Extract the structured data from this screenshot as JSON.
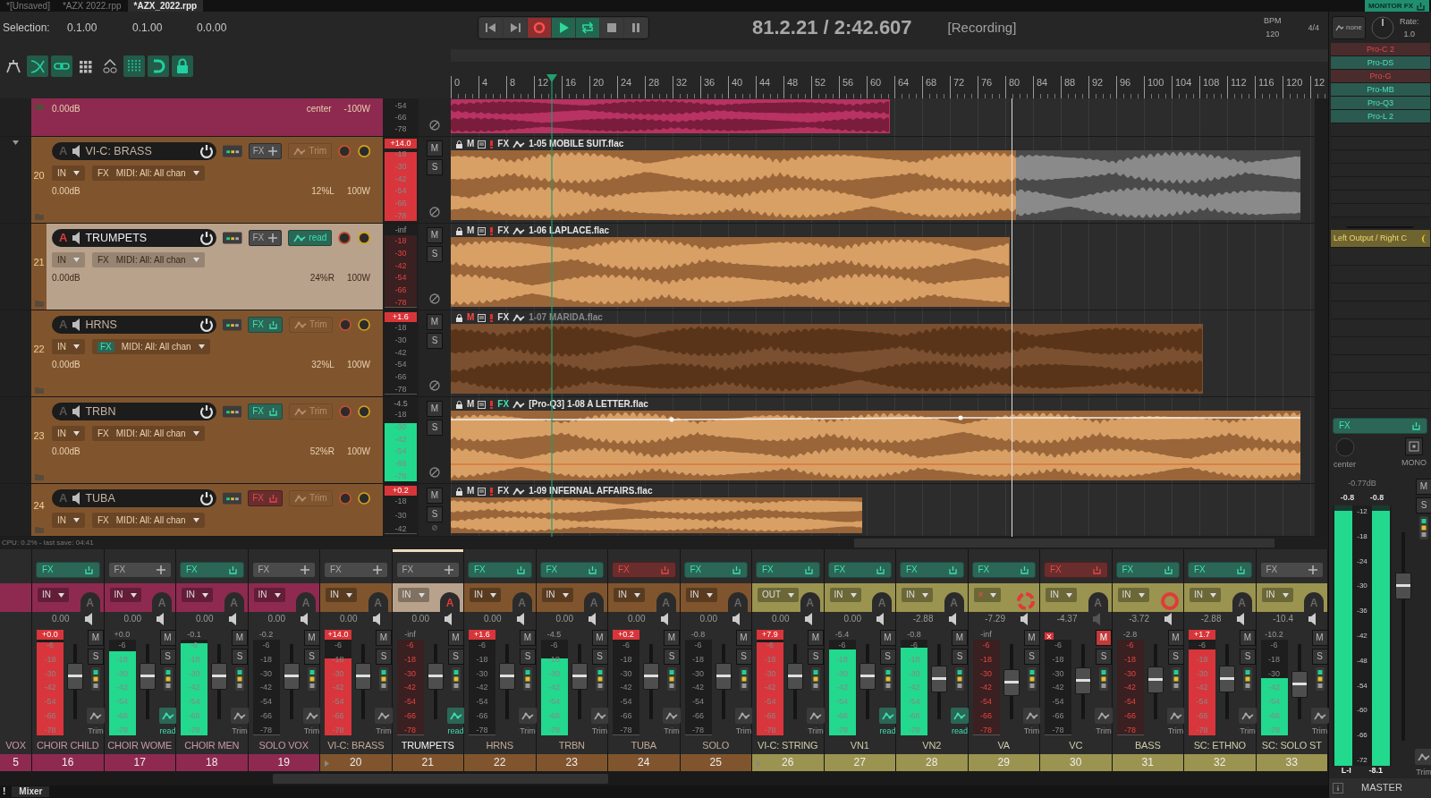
{
  "tabs": [
    {
      "label": "*[Unsaved]",
      "selected": false
    },
    {
      "label": "*AZX 2022.rpp",
      "selected": false
    },
    {
      "label": "*AZX_2022.rpp",
      "selected": true
    }
  ],
  "monitor_fx": {
    "label": "MONITOR FX",
    "on": true
  },
  "selection": {
    "label": "Selection:",
    "start": "0.1.00",
    "end": "0.1.00",
    "length": "0.0.00"
  },
  "transport": {
    "recording": true,
    "playing": true,
    "repeat": true
  },
  "time_display": "81.2.21 / 2:42.607",
  "play_state": "[Recording]",
  "tempo": {
    "label": "BPM",
    "value": "120",
    "signature": "4/4"
  },
  "toolbar": [
    {
      "kind": "ripple",
      "on": false
    },
    {
      "kind": "crossfade",
      "on": true
    },
    {
      "kind": "group",
      "on": true
    },
    {
      "kind": "grid",
      "on": false
    },
    {
      "kind": "envlink",
      "on": false
    },
    {
      "kind": "gridlines",
      "on": true
    },
    {
      "kind": "snap",
      "on": true
    },
    {
      "kind": "lock",
      "on": true
    }
  ],
  "ruler": [
    "0",
    "4",
    "8",
    "12",
    "16",
    "20",
    "24",
    "28",
    "32",
    "36",
    "40",
    "44",
    "48",
    "52",
    "56",
    "60",
    "64",
    "68",
    "72",
    "76",
    "80",
    "84",
    "88",
    "92",
    "96",
    "100",
    "104",
    "108",
    "112",
    "116",
    "120",
    "12"
  ],
  "tracks": [
    {
      "kind": "partial",
      "color": "#8e2a50",
      "selected": false,
      "volume": "0.00dB",
      "pan": "center",
      "width": "-100W",
      "meter": {
        "scale": [
          "-54",
          "-66",
          "-78"
        ]
      }
    },
    {
      "kind": "full",
      "number": "20",
      "folder": true,
      "name": "VI-C: BRASS",
      "color": "#80552e",
      "selected": false,
      "armed": false,
      "a": "A",
      "fx_label": "FX",
      "fx_loaded": false,
      "auto": "Trim",
      "auto_on": false,
      "input": "IN",
      "chain_fx": "FX",
      "chain_fx_on": false,
      "midi": "MIDI: All: All chan",
      "volume": "0.00dB",
      "pan": "12%L",
      "width": "100W",
      "meter": {
        "peak": "+14.0",
        "clip": true,
        "level": 0.95,
        "scale": [
          "-18",
          "-30",
          "-42",
          "-54",
          "-66",
          "-78"
        ]
      },
      "m": "M",
      "s": "S",
      "item": {
        "title": "1-05 MOBILE SUIT.flac",
        "m": "M",
        "fx_label": "FX",
        "muted": false,
        "fx": false,
        "envelope": false
      }
    },
    {
      "kind": "full",
      "number": "21",
      "folder": false,
      "name": "TRUMPETS",
      "color": "#80552e",
      "selected": true,
      "armed": true,
      "a": "A",
      "fx_label": "FX",
      "fx_loaded": false,
      "auto": "read",
      "auto_on": true,
      "input": "IN",
      "chain_fx": "FX",
      "chain_fx_on": false,
      "midi": "MIDI: All: All chan",
      "volume": "0.00dB",
      "pan": "24%R",
      "width": "100W",
      "meter": {
        "peak": "-inf",
        "clip": false,
        "level": 0,
        "scale": [
          "-18",
          "-30",
          "-42",
          "-54",
          "-66",
          "-78"
        ]
      },
      "m": "M",
      "s": "S",
      "item": {
        "title": "1-06 LAPLACE.flac",
        "m": "M",
        "fx_label": "FX",
        "muted": false,
        "fx": false,
        "envelope": false
      }
    },
    {
      "kind": "full",
      "number": "22",
      "folder": false,
      "name": "HRNS",
      "color": "#80552e",
      "selected": false,
      "armed": false,
      "a": "A",
      "fx_label": "FX",
      "fx_loaded": true,
      "fx_bypassed": false,
      "auto": "Trim",
      "auto_on": false,
      "input": "IN",
      "chain_fx": "FX",
      "chain_fx_on": true,
      "midi": "MIDI: All: All chan",
      "volume": "0.00dB",
      "pan": "32%L",
      "width": "100W",
      "meter": {
        "peak": "+1.6",
        "clip": true,
        "level": 0,
        "scale": [
          "-18",
          "-30",
          "-42",
          "-54",
          "-66",
          "-78"
        ]
      },
      "m": "M",
      "s": "S",
      "item": {
        "title": "1-07 MARIDA.flac",
        "m": "M",
        "fx_label": "FX",
        "muted": true,
        "fx": false,
        "envelope": false
      }
    },
    {
      "kind": "full",
      "number": "23",
      "folder": false,
      "name": "TRBN",
      "color": "#80552e",
      "selected": false,
      "armed": false,
      "a": "A",
      "fx_label": "FX",
      "fx_loaded": true,
      "fx_bypassed": false,
      "auto": "Trim",
      "auto_on": false,
      "input": "IN",
      "chain_fx": "FX",
      "chain_fx_on": false,
      "midi": "MIDI: All: All chan",
      "volume": "0.00dB",
      "pan": "52%R",
      "width": "100W",
      "meter": {
        "peak": "-4.5",
        "clip": false,
        "level": 0.8,
        "scale": [
          "-18",
          "-30",
          "-42",
          "-54",
          "-66",
          "-78"
        ]
      },
      "m": "M",
      "s": "S",
      "item": {
        "title": "[Pro-Q3] 1-08 A LETTER.flac",
        "m": "M",
        "fx_label": "FX",
        "muted": false,
        "fx": true,
        "envelope": true
      }
    },
    {
      "kind": "cut",
      "number": "24",
      "folder": false,
      "name": "TUBA",
      "color": "#80552e",
      "selected": false,
      "armed": false,
      "a": "A",
      "fx_label": "FX",
      "fx_loaded": true,
      "fx_bypassed": true,
      "auto": "Trim",
      "auto_on": false,
      "input": "IN",
      "chain_fx": "FX",
      "chain_fx_on": false,
      "midi": "MIDI: All: All chan",
      "meter": {
        "peak": "+0.2",
        "clip": true,
        "level": 0,
        "scale": [
          "-18",
          "-30",
          "-42"
        ]
      },
      "m": "M",
      "s": "S",
      "item": {
        "title": "1-09 INFERNAL AFFAIRS.flac",
        "m": "M",
        "fx_label": "FX",
        "muted": false,
        "fx": false,
        "envelope": false
      }
    }
  ],
  "status_bar": "CPU: 0.2% -  last save: 04:41",
  "mixer": {
    "strips": [
      {
        "kind": "partial",
        "n": "5",
        "name": "VOX",
        "color": "#8e2a50"
      },
      {
        "kind": "full",
        "n": "16",
        "name": "CHOIR CHILD",
        "color": "#8e2a50",
        "selected": false,
        "folder": false,
        "fx_loaded": true,
        "fx_bypassed": false,
        "fx_label": "FX",
        "input": "IN",
        "input_off": false,
        "auto_armed": false,
        "rec_arm": false,
        "rec_monitor": false,
        "a": "A",
        "vol": "0.00",
        "peak": "+0.0",
        "clip": true,
        "meter": {
          "level": 0.97
        },
        "fader": {
          "level": 0.62
        },
        "m": "M",
        "s": "S",
        "muted": false,
        "auto": "Trim",
        "auto_on": false,
        "scale": [
          "-6",
          "-18",
          "-30",
          "-42",
          "-54",
          "-66",
          "-78"
        ]
      },
      {
        "kind": "full",
        "n": "17",
        "name": "CHOIR WOME",
        "color": "#8e2a50",
        "selected": false,
        "folder": false,
        "fx_loaded": false,
        "fx_label": "FX",
        "input": "IN",
        "input_off": false,
        "auto_armed": false,
        "rec_arm": false,
        "rec_monitor": false,
        "a": "A",
        "vol": "0.00",
        "peak": "+0.0",
        "clip": false,
        "meter": {
          "level": 0.88
        },
        "fader": {
          "level": 0.62
        },
        "m": "M",
        "s": "S",
        "muted": false,
        "auto": "read",
        "auto_on": true,
        "scale": [
          "-6",
          "-18",
          "-30",
          "-42",
          "-54",
          "-66",
          "-78"
        ]
      },
      {
        "kind": "full",
        "n": "18",
        "name": "CHOIR MEN",
        "color": "#8e2a50",
        "selected": false,
        "folder": false,
        "fx_loaded": true,
        "fx_bypassed": false,
        "fx_label": "FX",
        "input": "IN",
        "input_off": false,
        "auto_armed": false,
        "rec_arm": false,
        "rec_monitor": false,
        "a": "A",
        "vol": "0.00",
        "peak": "-0.1",
        "clip": false,
        "meter": {
          "level": 0.96
        },
        "fader": {
          "level": 0.62
        },
        "m": "M",
        "s": "S",
        "muted": false,
        "auto": "Trim",
        "auto_on": false,
        "scale": [
          "-6",
          "-18",
          "-30",
          "-42",
          "-54",
          "-66",
          "-78"
        ]
      },
      {
        "kind": "full",
        "n": "19",
        "name": "SOLO VOX",
        "color": "#8e2a50",
        "selected": false,
        "folder": false,
        "fx_loaded": false,
        "fx_label": "FX",
        "input": "IN",
        "input_off": false,
        "auto_armed": false,
        "rec_arm": false,
        "rec_monitor": false,
        "a": "A",
        "vol": "0.00",
        "peak": "-0.2",
        "clip": false,
        "meter": {
          "level": 0
        },
        "fader": {
          "level": 0.62
        },
        "m": "M",
        "s": "S",
        "muted": false,
        "auto": "Trim",
        "auto_on": false,
        "scale": [
          "-6",
          "-18",
          "-30",
          "-42",
          "-54",
          "-66",
          "-78"
        ]
      },
      {
        "kind": "full",
        "n": "20",
        "name": "VI-C: BRASS",
        "color": "#80552e",
        "selected": false,
        "folder": true,
        "fx_loaded": false,
        "fx_label": "FX",
        "input": "IN",
        "input_off": false,
        "auto_armed": false,
        "rec_arm": false,
        "rec_monitor": false,
        "a": "A",
        "vol": "0.00",
        "peak": "+14.0",
        "clip": true,
        "meter": {
          "level": 0.8
        },
        "fader": {
          "level": 0.62
        },
        "m": "M",
        "s": "S",
        "muted": false,
        "auto": "Trim",
        "auto_on": false,
        "scale": [
          "-6",
          "-18",
          "-30",
          "-42",
          "-54",
          "-66",
          "-78"
        ]
      },
      {
        "kind": "full",
        "n": "21",
        "name": "TRUMPETS",
        "color": "#80552e",
        "selected": true,
        "folder": false,
        "fx_loaded": false,
        "fx_label": "FX",
        "input": "IN",
        "input_off": false,
        "auto_armed": true,
        "rec_arm": false,
        "rec_monitor": false,
        "a": "A",
        "vol": "0.00",
        "peak": "-inf",
        "clip": false,
        "meter": {
          "level": 0
        },
        "fader": {
          "level": 0.62
        },
        "m": "M",
        "s": "S",
        "muted": false,
        "auto": "read",
        "auto_on": true,
        "scale": [
          "-6",
          "-18",
          "-30",
          "-42",
          "-54",
          "-66",
          "-78"
        ]
      },
      {
        "kind": "full",
        "n": "22",
        "name": "HRNS",
        "color": "#80552e",
        "selected": false,
        "folder": false,
        "fx_loaded": true,
        "fx_bypassed": false,
        "fx_label": "FX",
        "input": "IN",
        "input_off": false,
        "auto_armed": false,
        "rec_arm": false,
        "rec_monitor": false,
        "a": "A",
        "vol": "0.00",
        "peak": "+1.6",
        "clip": true,
        "meter": {
          "level": 0
        },
        "fader": {
          "level": 0.62
        },
        "m": "M",
        "s": "S",
        "muted": false,
        "auto": "Trim",
        "auto_on": false,
        "scale": [
          "-6",
          "-18",
          "-30",
          "-42",
          "-54",
          "-66",
          "-78"
        ]
      },
      {
        "kind": "full",
        "n": "23",
        "name": "TRBN",
        "color": "#80552e",
        "selected": false,
        "folder": false,
        "fx_loaded": true,
        "fx_bypassed": false,
        "fx_label": "FX",
        "input": "IN",
        "input_off": false,
        "auto_armed": false,
        "rec_arm": false,
        "rec_monitor": false,
        "a": "A",
        "vol": "0.00",
        "peak": "-4.5",
        "clip": false,
        "meter": {
          "level": 0.8
        },
        "fader": {
          "level": 0.62
        },
        "m": "M",
        "s": "S",
        "muted": false,
        "auto": "Trim",
        "auto_on": false,
        "scale": [
          "-6",
          "-18",
          "-30",
          "-42",
          "-54",
          "-66",
          "-78"
        ]
      },
      {
        "kind": "full",
        "n": "24",
        "name": "TUBA",
        "color": "#80552e",
        "selected": false,
        "folder": false,
        "fx_loaded": true,
        "fx_bypassed": true,
        "fx_label": "FX",
        "input": "IN",
        "input_off": false,
        "auto_armed": false,
        "rec_arm": false,
        "rec_monitor": false,
        "a": "A",
        "vol": "0.00",
        "peak": "+0.2",
        "clip": true,
        "meter": {
          "level": 0
        },
        "fader": {
          "level": 0.62
        },
        "m": "M",
        "s": "S",
        "muted": false,
        "auto": "Trim",
        "auto_on": false,
        "scale": [
          "-6",
          "-18",
          "-30",
          "-42",
          "-54",
          "-66",
          "-78"
        ]
      },
      {
        "kind": "full",
        "n": "25",
        "name": "SOLO",
        "color": "#80552e",
        "selected": false,
        "folder": false,
        "fx_loaded": true,
        "fx_bypassed": false,
        "fx_label": "FX",
        "input": "IN",
        "input_off": false,
        "auto_armed": false,
        "rec_arm": false,
        "rec_monitor": false,
        "a": "A",
        "vol": "0.00",
        "peak": "-0.8",
        "clip": false,
        "meter": {
          "level": 0
        },
        "fader": {
          "level": 0.62
        },
        "m": "M",
        "s": "S",
        "muted": false,
        "auto": "Trim",
        "auto_on": false,
        "scale": [
          "-6",
          "-18",
          "-30",
          "-42",
          "-54",
          "-66",
          "-78"
        ]
      },
      {
        "kind": "full",
        "n": "26",
        "name": "VI-C: STRING",
        "color": "#9a9450",
        "selected": false,
        "folder": true,
        "fx_loaded": true,
        "fx_bypassed": false,
        "fx_label": "FX",
        "input": "OUT",
        "input_off": false,
        "auto_armed": false,
        "rec_arm": false,
        "rec_monitor": false,
        "a": "A",
        "vol": "0.00",
        "peak": "+7.9",
        "clip": true,
        "meter": {
          "level": 0.97
        },
        "fader": {
          "level": 0.62
        },
        "m": "M",
        "s": "S",
        "muted": false,
        "auto": "Trim",
        "auto_on": false,
        "scale": [
          "-6",
          "-18",
          "-30",
          "-42",
          "-54",
          "-66",
          "-78"
        ]
      },
      {
        "kind": "full",
        "n": "27",
        "name": "VN1",
        "color": "#9a9450",
        "selected": false,
        "folder": false,
        "fx_loaded": true,
        "fx_bypassed": false,
        "fx_label": "FX",
        "input": "IN",
        "input_off": false,
        "auto_armed": false,
        "rec_arm": false,
        "rec_monitor": false,
        "a": "A",
        "vol": "0.00",
        "peak": "-5.4",
        "clip": false,
        "meter": {
          "level": 0.9
        },
        "fader": {
          "level": 0.62
        },
        "m": "M",
        "s": "S",
        "muted": false,
        "auto": "read",
        "auto_on": true,
        "scale": [
          "-6",
          "-18",
          "-30",
          "-42",
          "-54",
          "-66",
          "-78"
        ]
      },
      {
        "kind": "full",
        "n": "28",
        "name": "VN2",
        "color": "#9a9450",
        "selected": false,
        "folder": false,
        "fx_loaded": true,
        "fx_bypassed": false,
        "fx_label": "FX",
        "input": "IN",
        "input_off": false,
        "auto_armed": false,
        "rec_arm": false,
        "rec_monitor": false,
        "a": "A",
        "vol": "-2.88",
        "peak": "-0.8",
        "clip": false,
        "meter": {
          "level": 0.92
        },
        "fader": {
          "level": 0.55
        },
        "m": "M",
        "s": "S",
        "muted": false,
        "auto": "read",
        "auto_on": true,
        "scale": [
          "-6",
          "-18",
          "-30",
          "-42",
          "-54",
          "-66",
          "-78"
        ]
      },
      {
        "kind": "full",
        "n": "29",
        "name": "VA",
        "color": "#9a9450",
        "selected": false,
        "folder": false,
        "fx_loaded": true,
        "fx_bypassed": false,
        "fx_label": "FX",
        "input": "×",
        "input_off": true,
        "rec_arm": false,
        "rec_monitor": true,
        "vol": "-7.29",
        "peak": "-inf",
        "clip": false,
        "meter": {
          "level": 0
        },
        "fader": {
          "level": 0.48
        },
        "m": "M",
        "s": "S",
        "muted": false,
        "auto": "Trim",
        "auto_on": false,
        "scale": [
          "-6",
          "-18",
          "-30",
          "-42",
          "-54",
          "-66",
          "-78"
        ]
      },
      {
        "kind": "full",
        "n": "30",
        "name": "VC",
        "color": "#9a9450",
        "selected": false,
        "folder": false,
        "fx_loaded": true,
        "fx_bypassed": true,
        "fx_label": "FX",
        "input": "IN",
        "input_off": false,
        "auto_armed": false,
        "rec_arm": false,
        "rec_monitor": false,
        "a": "A",
        "vol": "-4.37",
        "clip": true,
        "meter": {
          "level": 0
        },
        "fader": {
          "level": 0.52
        },
        "m": "M",
        "s": "S",
        "muted": true,
        "auto": "Trim",
        "auto_on": false,
        "scale": [
          "-6",
          "-18",
          "-30",
          "-42",
          "-54",
          "-66",
          "-78"
        ]
      },
      {
        "kind": "full",
        "n": "31",
        "name": "BASS",
        "color": "#9a9450",
        "selected": false,
        "folder": false,
        "fx_loaded": true,
        "fx_bypassed": false,
        "fx_label": "FX",
        "input": "IN",
        "input_off": false,
        "rec_arm": true,
        "rec_monitor": false,
        "vol": "-3.72",
        "peak": "-2.8",
        "clip": false,
        "meter": {
          "level": 0
        },
        "fader": {
          "level": 0.53
        },
        "m": "M",
        "s": "S",
        "muted": false,
        "auto": "Trim",
        "auto_on": false,
        "scale": [
          "-6",
          "-18",
          "-30",
          "-42",
          "-54",
          "-66",
          "-78"
        ]
      },
      {
        "kind": "full",
        "n": "32",
        "name": "SC: ETHNO",
        "color": "#9a9450",
        "selected": false,
        "folder": false,
        "fx_loaded": true,
        "fx_bypassed": false,
        "fx_label": "FX",
        "input": "IN",
        "input_off": false,
        "auto_armed": false,
        "rec_arm": false,
        "rec_monitor": false,
        "a": "A",
        "vol": "-2.88",
        "peak": "+1.7",
        "clip": true,
        "meter": {
          "level": 0.9
        },
        "fader": {
          "level": 0.55
        },
        "m": "M",
        "s": "S",
        "muted": false,
        "auto": "Trim",
        "auto_on": false,
        "scale": [
          "-6",
          "-18",
          "-30",
          "-42",
          "-54",
          "-66",
          "-78"
        ]
      },
      {
        "kind": "full",
        "n": "33",
        "name": "SC: SOLO ST",
        "color": "#9a9450",
        "selected": false,
        "folder": false,
        "fx_loaded": false,
        "fx_label": "FX",
        "input": "IN",
        "input_off": false,
        "auto_armed": false,
        "rec_arm": false,
        "rec_monitor": false,
        "a": "A",
        "vol": "-10.4",
        "peak": "-10.2",
        "clip": false,
        "meter": {
          "level": 0.6
        },
        "fader": {
          "level": 0.45
        },
        "m": "M",
        "s": "S",
        "muted": false,
        "auto": "Trim",
        "auto_on": false,
        "scale": [
          "-6",
          "-18",
          "-30",
          "-42",
          "-54",
          "-66",
          "-78"
        ]
      }
    ],
    "master": {
      "fx_label": "FX",
      "fx_loaded": true,
      "fx_bypassed": false,
      "pan": "center",
      "mono": "MONO",
      "vol": "-0.77dB",
      "peak_l": "-0.8",
      "peak_r": "-0.8",
      "m": "M",
      "s": "S",
      "meter_l": {
        "level": 0.98
      },
      "meter_r": {
        "level": 0.98
      },
      "scale": [
        "-12",
        "-18",
        "-24",
        "-30",
        "-36",
        "-42",
        "-48",
        "-54",
        "-60",
        "-66",
        "-72"
      ],
      "fader": {
        "level": 0.78
      },
      "auto": "Trim",
      "label_l": "L-I",
      "label_r": "-8.1",
      "name": "MASTER"
    }
  },
  "right_panel": {
    "envelope": "none",
    "rate_label": "Rate:",
    "rate": "1.0",
    "fx_chain": [
      {
        "name": "Pro-C 2",
        "bypassed": true
      },
      {
        "name": "Pro-DS",
        "bypassed": false
      },
      {
        "name": "Pro-G",
        "bypassed": true
      },
      {
        "name": "Pro-MB",
        "bypassed": false
      },
      {
        "name": "Pro-Q3",
        "bypassed": false
      },
      {
        "name": "Pro-L 2",
        "bypassed": false
      }
    ],
    "routing": [
      {
        "name": "Left Output / Right C"
      }
    ]
  },
  "dock": {
    "alert": "!",
    "tab": "Mixer"
  }
}
